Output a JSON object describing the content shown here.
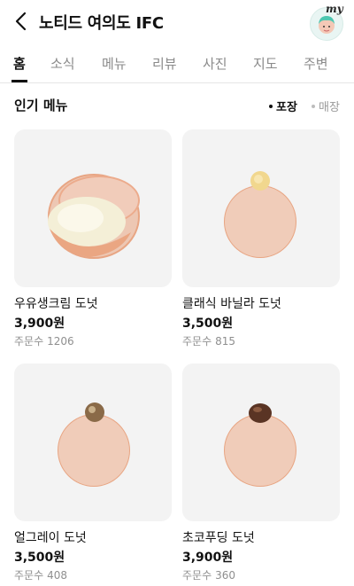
{
  "header": {
    "title": "노티드 여의도 IFC",
    "avatar_badge": "my",
    "back_icon": "chevron-left-icon"
  },
  "tabs": [
    {
      "label": "홈",
      "active": true
    },
    {
      "label": "소식",
      "active": false
    },
    {
      "label": "메뉴",
      "active": false
    },
    {
      "label": "리뷰",
      "active": false
    },
    {
      "label": "사진",
      "active": false
    },
    {
      "label": "지도",
      "active": false
    },
    {
      "label": "주변",
      "active": false
    }
  ],
  "section": {
    "title": "인기 메뉴",
    "filters": [
      {
        "label": "포장",
        "selected": true
      },
      {
        "label": "매장",
        "selected": false
      }
    ]
  },
  "menu": [
    {
      "name": "우유생크림 도넛",
      "price": "3,900원",
      "orders_label": "주문수",
      "orders": "1206"
    },
    {
      "name": "클래식 바닐라 도넛",
      "price": "3,500원",
      "orders_label": "주문수",
      "orders": "815"
    },
    {
      "name": "얼그레이 도넛",
      "price": "3,500원",
      "orders_label": "주문수",
      "orders": "408"
    },
    {
      "name": "초코푸딩 도넛",
      "price": "3,900원",
      "orders_label": "주문수",
      "orders": "360"
    }
  ],
  "colors": {
    "card_bg": "#f3f3f3",
    "donut": "#e8a583",
    "sugar": "#f6ece6",
    "vanilla_top": "#f1d78e",
    "earl_grey_top": "#8a6a48",
    "choco_top": "#5a3424"
  }
}
